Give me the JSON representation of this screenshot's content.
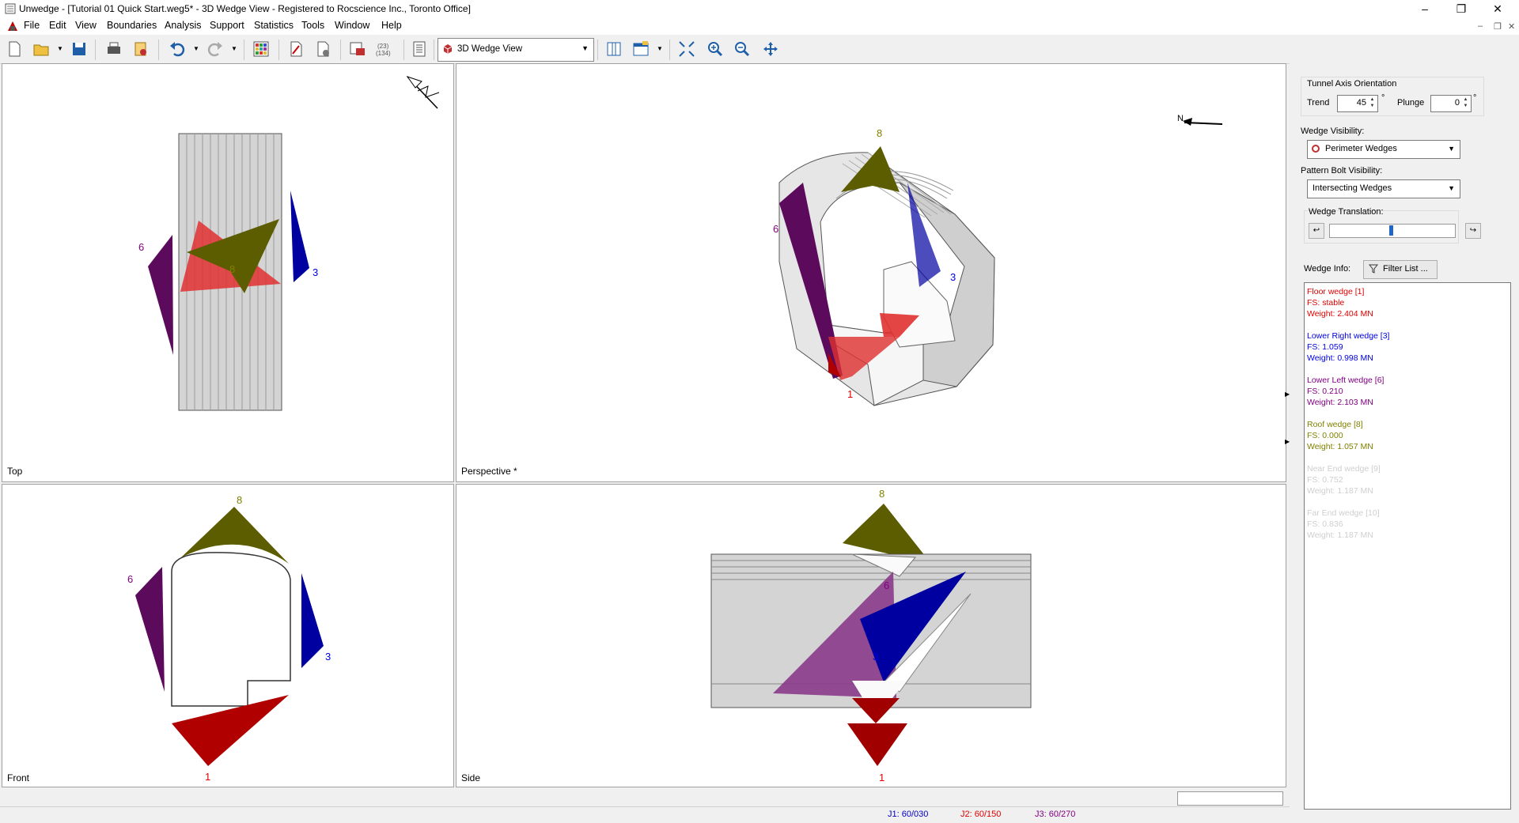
{
  "window": {
    "title": "Unwedge - [Tutorial 01 Quick Start.weg5* - 3D Wedge View - Registered to Rocscience Inc., Toronto Office]"
  },
  "menu": [
    "File",
    "Edit",
    "View",
    "Boundaries",
    "Analysis",
    "Support",
    "Statistics",
    "Tools",
    "Window",
    "Help"
  ],
  "toolbar": {
    "view_select": "3D Wedge View"
  },
  "panes": {
    "top": "Top",
    "perspective": "Perspective *",
    "front": "Front",
    "side": "Side"
  },
  "north_label": "N",
  "wedge_labels": {
    "top": [
      "6",
      "8",
      "3"
    ],
    "perspective": [
      "8",
      "6",
      "3",
      "1"
    ],
    "front": [
      "8",
      "6",
      "3",
      "1"
    ],
    "side": [
      "8",
      "6",
      "3",
      "1"
    ]
  },
  "tunnel_axis": {
    "group_label": "Tunnel Axis Orientation",
    "trend_label": "Trend",
    "trend_value": "45",
    "plunge_label": "Plunge",
    "plunge_value": "0",
    "degree_symbol": "°"
  },
  "wedge_visibility": {
    "label": "Wedge Visibility:",
    "value": "Perimeter Wedges"
  },
  "pattern_bolt_visibility": {
    "label": "Pattern Bolt Visibility:",
    "value": "Intersecting Wedges"
  },
  "wedge_translation": {
    "label": "Wedge Translation:",
    "slider_fraction": 0.5
  },
  "wedge_info": {
    "label": "Wedge Info:",
    "filter_button": "Filter List ...",
    "items": [
      {
        "name": "Floor wedge [1]",
        "fs": "FS: stable",
        "weight": "Weight: 2.404 MN",
        "color": "#e00000"
      },
      {
        "name": "Lower Right wedge [3]",
        "fs": "FS: 1.059",
        "weight": "Weight: 0.998 MN",
        "color": "#0000e0"
      },
      {
        "name": "Lower Left wedge [6]",
        "fs": "FS: 0.210",
        "weight": "Weight: 2.103 MN",
        "color": "#800080"
      },
      {
        "name": "Roof wedge [8]",
        "fs": "FS: 0.000",
        "weight": "Weight: 1.057 MN",
        "color": "#808000"
      },
      {
        "name": "Near End wedge [9]",
        "fs": "FS: 0.752",
        "weight": "Weight: 1.187 MN",
        "color": "#cfcfcf"
      },
      {
        "name": "Far End wedge [10]",
        "fs": "FS: 0.836",
        "weight": "Weight: 1.187 MN",
        "color": "#cfcfcf"
      }
    ]
  },
  "status": {
    "j1": "J1: 60/030",
    "j2": "J2: 60/150",
    "j3": "J3: 60/270",
    "j1_color": "#0000c0",
    "j2_color": "#e00000",
    "j3_color": "#800080"
  },
  "colors": {
    "roof": "#5c5c00",
    "left": "#5c0a5c",
    "right": "#0000a0",
    "floor": "#b00000",
    "tunnel": "#d4d4d4"
  }
}
